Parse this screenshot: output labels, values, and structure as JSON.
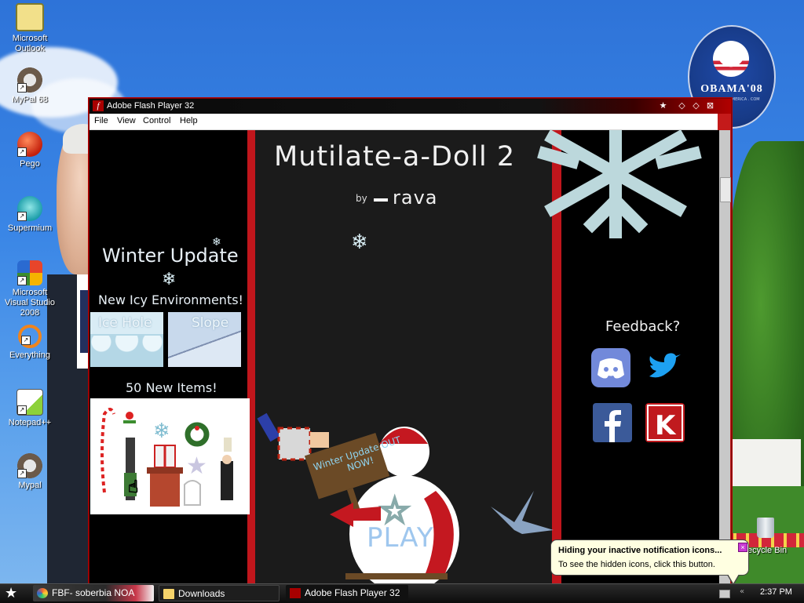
{
  "desktop": {
    "icons": [
      {
        "label": "Microsoft Outlook",
        "icon": "outlook-icon"
      },
      {
        "label": "MyPal 68",
        "icon": "mypal-icon"
      },
      {
        "label": "Pego",
        "icon": "pego-icon"
      },
      {
        "label": "Supermium",
        "icon": "supermium-icon"
      },
      {
        "label": "Microsoft Visual Studio 2008",
        "icon": "visual-studio-icon"
      },
      {
        "label": "Everything",
        "icon": "everything-icon"
      },
      {
        "label": "Notepad++",
        "icon": "notepadpp-icon"
      },
      {
        "label": "Mypal",
        "icon": "mypal-icon"
      }
    ],
    "recycle_bin_label": "ecycle Bin",
    "badge": {
      "name": "OBAMA'08",
      "small_text": "OBAMA FOR AMERICA . COM"
    }
  },
  "window": {
    "title": "Adobe Flash Player 32",
    "menu": [
      "File",
      "View",
      "Control",
      "Help"
    ]
  },
  "game": {
    "title": "Mutilate-a-Doll 2",
    "by": "by",
    "author": "rava",
    "winter_update": "Winter Update",
    "icy_environments": "New Icy Environments!",
    "environments": [
      "Ice Hole",
      "Slope"
    ],
    "new_items": "50 New Items!",
    "feedback": "Feedback?",
    "sign_text": "Winter Update OUT NOW!",
    "play_label": "PLAY",
    "social": [
      "discord-icon",
      "twitter-icon",
      "facebook-icon",
      "kongregate-icon"
    ]
  },
  "taskbar": {
    "tasks": [
      {
        "label": "FBF- soberbia NOA",
        "icon": "pinwheel-icon"
      },
      {
        "label": "Downloads",
        "icon": "folder-icon"
      },
      {
        "label": "Adobe Flash Player 32",
        "icon": "flash-icon"
      }
    ],
    "clock": "2:37 PM"
  },
  "balloon": {
    "title": "Hiding your inactive notification icons...",
    "body": "To see the hidden icons, click this button."
  },
  "colors": {
    "flash_red": "#c0161c",
    "discord": "#7289da",
    "twitter": "#1da1f2",
    "facebook": "#3b5a99",
    "kongregate": "#c01a1e"
  }
}
